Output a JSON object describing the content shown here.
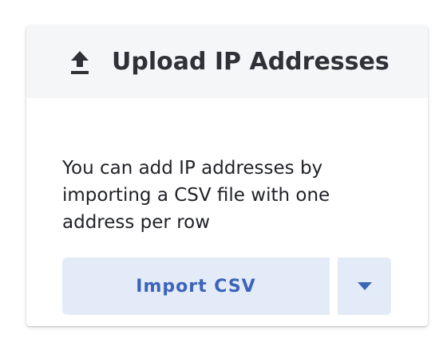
{
  "card": {
    "title": "Upload IP Addresses",
    "header_icon": "upload-icon",
    "description": "You can add IP addresses by importing a CSV file with one address per row"
  },
  "actions": {
    "import_label": "Import CSV",
    "dropdown_icon": "caret-down-icon"
  },
  "colors": {
    "header_bg": "#f5f6f8",
    "button_bg": "#e3ebf9",
    "button_text": "#3b63b8",
    "title_text": "#2f3137"
  }
}
